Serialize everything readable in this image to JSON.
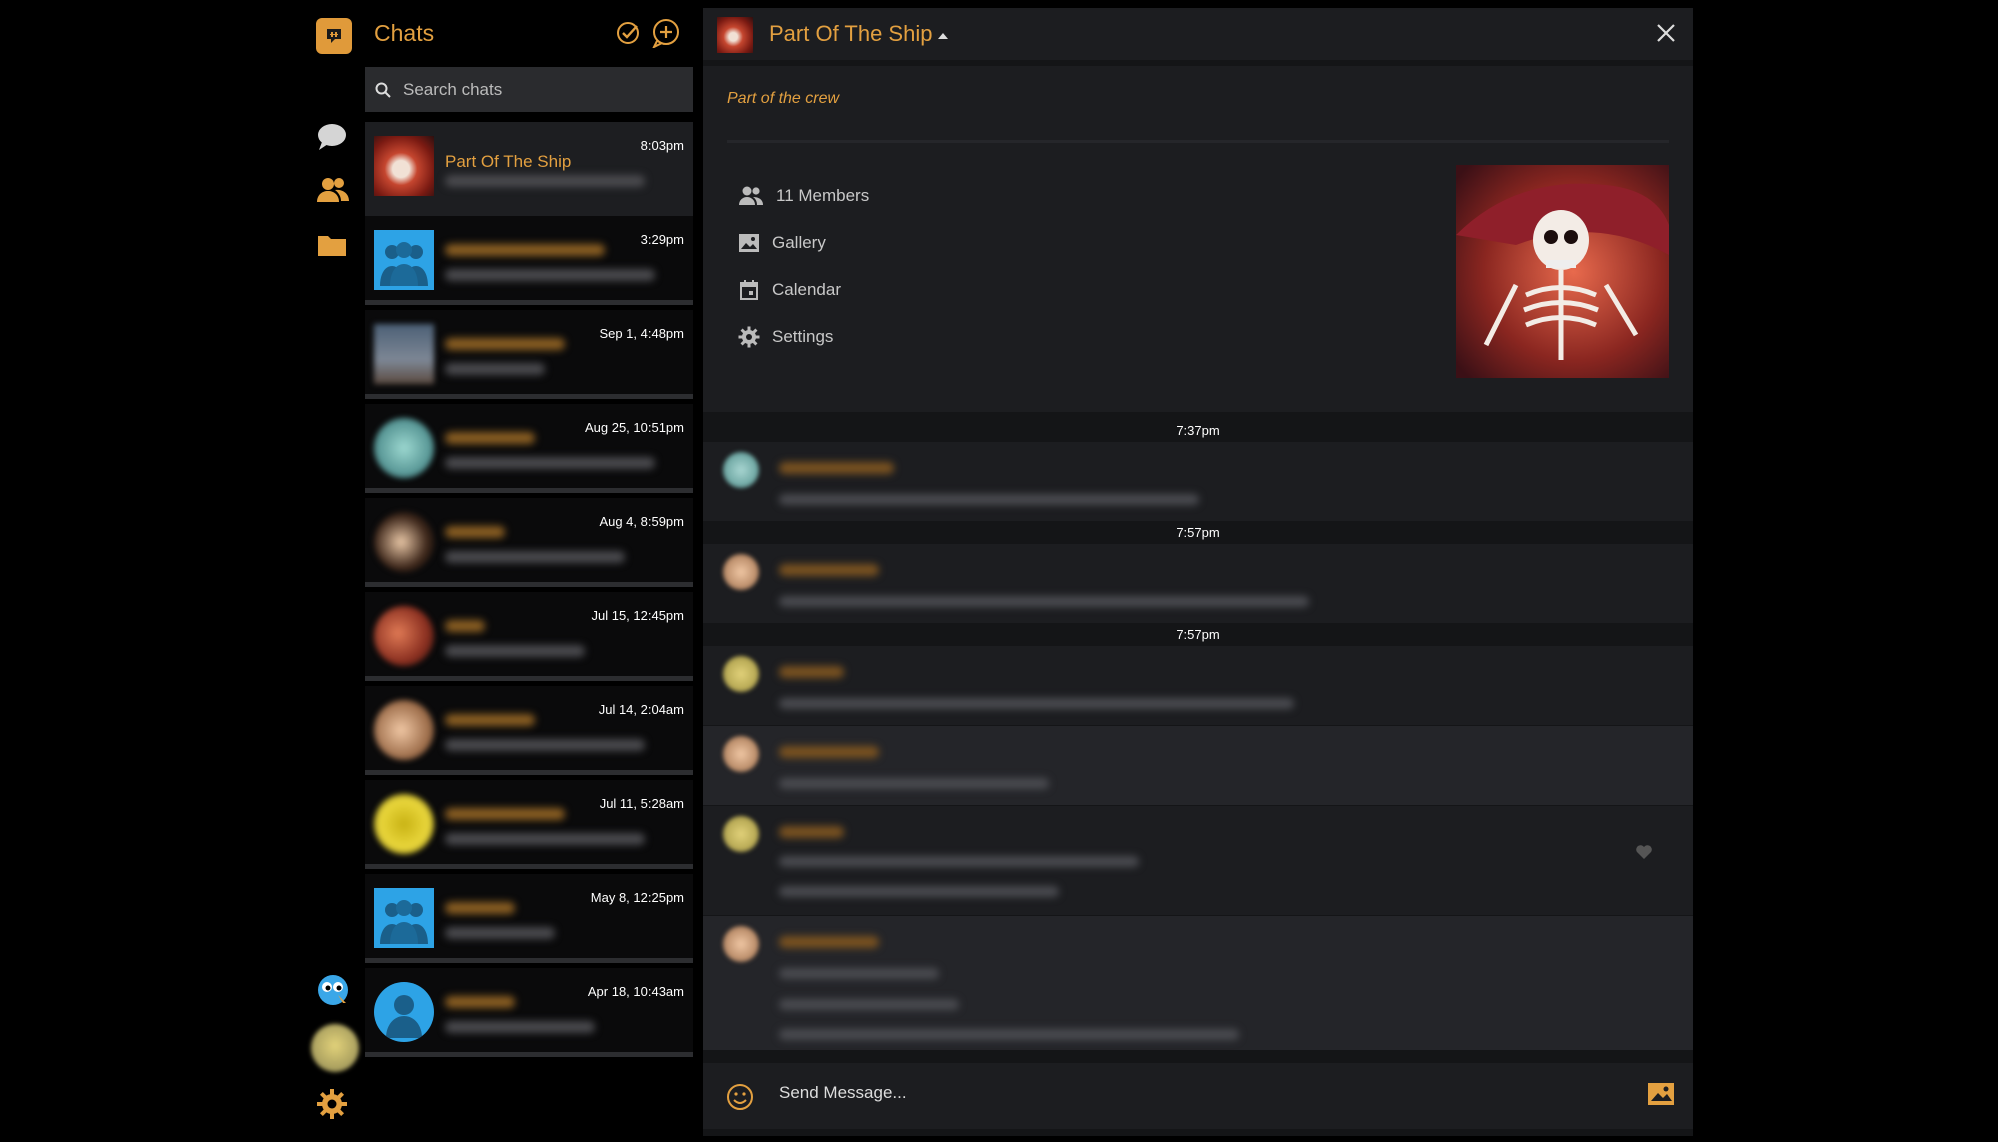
{
  "chats_panel": {
    "title": "Chats",
    "search_placeholder": "Search chats"
  },
  "chat_list": [
    {
      "name": "Part Of The Ship",
      "time": "8:03pm",
      "active": true
    },
    {
      "name": "",
      "time": "3:29pm"
    },
    {
      "name": "",
      "time": "Sep 1, 4:48pm"
    },
    {
      "name": "",
      "time": "Aug 25, 10:51pm"
    },
    {
      "name": "",
      "time": "Aug 4, 8:59pm"
    },
    {
      "name": "",
      "time": "Jul 15, 12:45pm"
    },
    {
      "name": "",
      "time": "Jul 14, 2:04am"
    },
    {
      "name": "",
      "time": "Jul 11, 5:28am"
    },
    {
      "name": "",
      "time": "May 8, 12:25pm"
    },
    {
      "name": "",
      "time": "Apr 18, 10:43am"
    }
  ],
  "conversation": {
    "title": "Part Of The Ship",
    "subtitle": "Part of the crew",
    "menu": {
      "members": "11 Members",
      "gallery": "Gallery",
      "calendar": "Calendar",
      "settings": "Settings"
    },
    "timestamps": [
      "7:37pm",
      "7:57pm",
      "7:57pm"
    ],
    "composer_placeholder": "Send Message..."
  },
  "colors": {
    "accent": "#e3a040",
    "background": "#000000",
    "panel": "#1c1d20"
  }
}
